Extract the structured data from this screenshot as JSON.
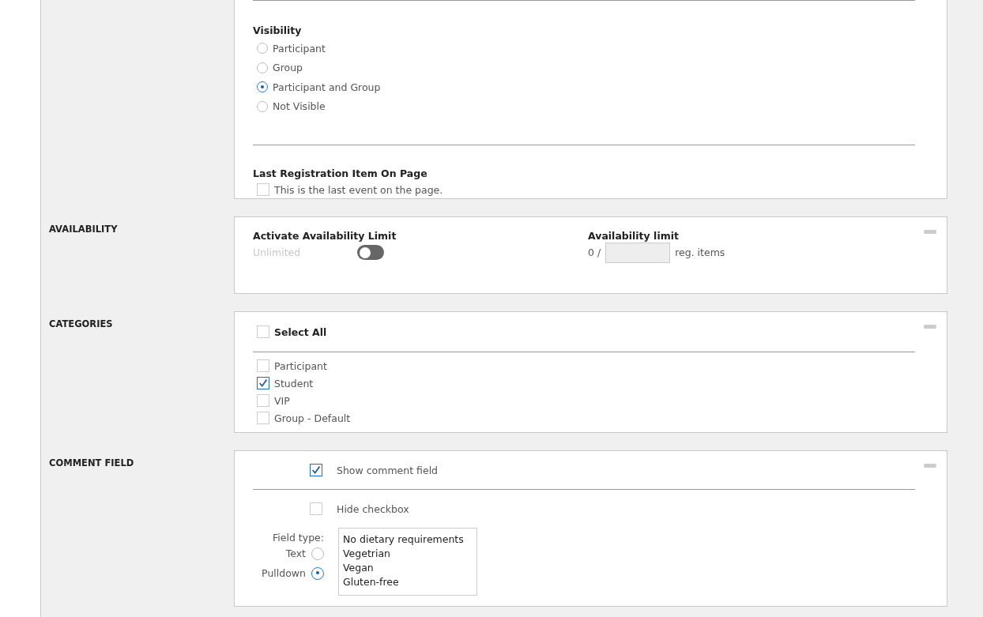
{
  "visibility": {
    "label": "Visibility",
    "options": [
      {
        "label": "Participant",
        "selected": false
      },
      {
        "label": "Group",
        "selected": false
      },
      {
        "label": "Participant and Group",
        "selected": true
      },
      {
        "label": "Not Visible",
        "selected": false
      }
    ]
  },
  "last_item": {
    "label": "Last Registration Item On Page",
    "checkbox": {
      "label": "This is the last event on the page.",
      "checked": false
    }
  },
  "availability": {
    "section": "AVAILABILITY",
    "activate_label": "Activate Availability Limit",
    "toggle_text": "Unlimited",
    "on": false,
    "limit_label": "Availability limit",
    "count": "0 /",
    "unit": "reg. items"
  },
  "categories": {
    "section": "CATEGORIES",
    "select_all": {
      "label": "Select All",
      "checked": false
    },
    "items": [
      {
        "label": "Participant",
        "checked": false
      },
      {
        "label": "Student",
        "checked": true
      },
      {
        "label": "VIP",
        "checked": false
      },
      {
        "label": "Group - Default",
        "checked": false
      }
    ]
  },
  "comment_field": {
    "section": "COMMENT FIELD",
    "show": {
      "label": "Show comment field",
      "checked": true
    },
    "hide": {
      "label": "Hide checkbox",
      "checked": false
    },
    "field_type_label": "Field type:",
    "types": [
      {
        "label": "Text",
        "selected": false
      },
      {
        "label": "Pulldown",
        "selected": true
      }
    ],
    "options": [
      "No dietary requirements",
      "Vegetrian",
      "Vegan",
      "Gluten-free"
    ]
  }
}
